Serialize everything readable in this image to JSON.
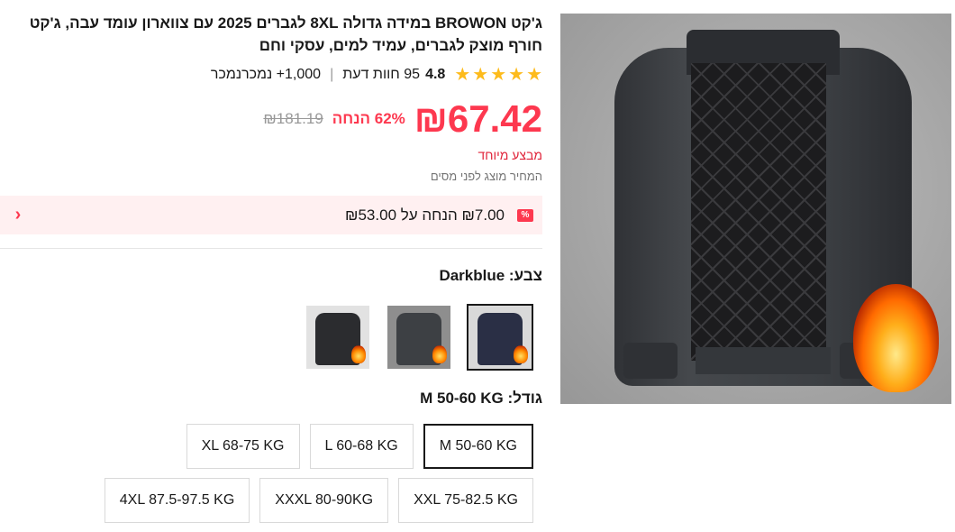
{
  "product": {
    "title": "ג'קט BROWON במידה גדולה 8XL לגברים 2025 עם צווארון עומד עבה, ג'קט חורף מוצק לגברים, עמיד למים, עסקי וחם",
    "rating": "4.8",
    "reviews": "95 חוות דעת",
    "sold": "1,000+ נמכרנמכר",
    "stars": 5
  },
  "price": {
    "current": "₪67.42",
    "discount": "62% הנחה",
    "original": "₪181.19",
    "promo_label": "מבצע מיוחד",
    "tax_note": "המחיר מוצג לפני מסים"
  },
  "coupon": {
    "icon": "%",
    "text": "₪7.00 הנחה על ₪53.00"
  },
  "colors": {
    "label": "צבע: Darkblue",
    "options": [
      {
        "name": "Darkblue",
        "swatch": "#2a2f45"
      },
      {
        "name": "Gray",
        "swatch": "#3d4044"
      },
      {
        "name": "Black",
        "swatch": "#2b2c2f"
      }
    ]
  },
  "sizes": {
    "label": "גודל: M 50-60 KG",
    "row1": [
      "M 50-60 KG",
      "L 60-68 KG",
      "XL 68-75 KG"
    ],
    "row2": [
      "XXL 75-82.5 KG",
      "XXXL 80-90KG",
      "4XL 87.5-97.5 KG"
    ]
  }
}
